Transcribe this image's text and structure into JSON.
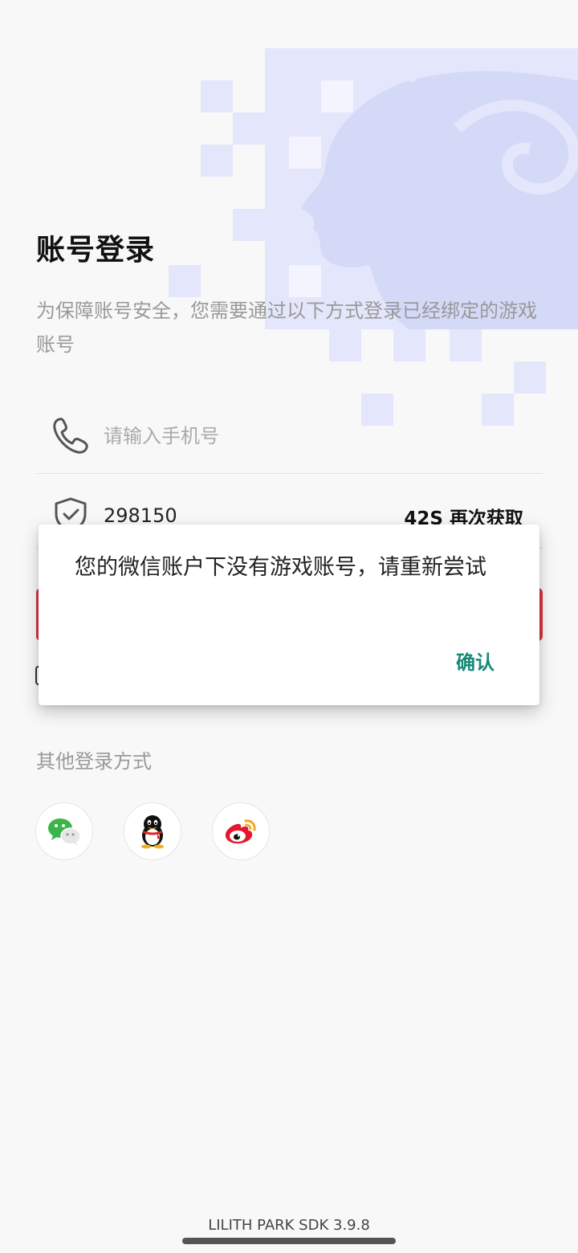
{
  "header": {
    "title": "账号登录",
    "subtitle": "为保障账号安全，您需要通过以下方式登录已经绑定的游戏账号"
  },
  "form": {
    "phone_placeholder": "请输入手机号",
    "phone_value": "",
    "code_value": "298150",
    "resend_label": "42S 再次获取"
  },
  "other_login": {
    "label": "其他登录方式",
    "options": [
      "wechat-icon",
      "qq-icon",
      "weibo-icon"
    ]
  },
  "dialog": {
    "message": "您的微信账户下没有游戏账号，请重新尝试",
    "confirm_label": "确认"
  },
  "footer": {
    "sdk_version": "LILITH PARK SDK 3.9.8"
  },
  "colors": {
    "accent_red": "#d9363e",
    "confirm_teal": "#15897a",
    "background": "#f8f8f8"
  }
}
